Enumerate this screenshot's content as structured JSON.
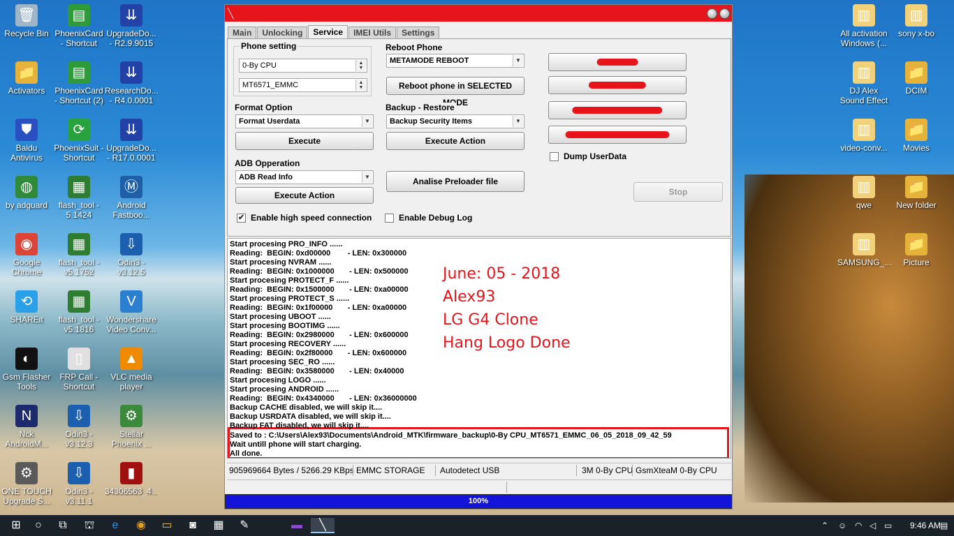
{
  "desktop": {
    "left_icons": [
      {
        "label": "Recycle Bin",
        "icon": "recycle-bin-icon",
        "glyph": "🗑",
        "color": "#9fb6c8"
      },
      {
        "label": "PhoenixCard\n- Shortcut",
        "icon": "phoenixcard-icon",
        "glyph": "▤",
        "color": "#2e9a3a"
      },
      {
        "label": "UpgradeDo...\n- R2.9.9015",
        "icon": "upgrade-download-icon",
        "glyph": "⇊",
        "color": "#2242a8"
      },
      {
        "label": "Activators",
        "icon": "folder-icon",
        "glyph": "📁",
        "color": "#e6b33a"
      },
      {
        "label": "PhoenixCard\n- Shortcut (2)",
        "icon": "phoenixcard-icon",
        "glyph": "▤",
        "color": "#2e9a3a"
      },
      {
        "label": "ResearchDo...\n- R4.0.0001",
        "icon": "research-download-icon",
        "glyph": "⇊",
        "color": "#2242a8"
      },
      {
        "label": "Baidu\nAntivirus",
        "icon": "baidu-antivirus-icon",
        "glyph": "⛊",
        "color": "#2a4fc0"
      },
      {
        "label": "PhoenixSuit -\nShortcut",
        "icon": "phoenixsuit-icon",
        "glyph": "⟳",
        "color": "#27a23c"
      },
      {
        "label": "UpgradeDo...\n- R17.0.0001",
        "icon": "upgrade-download-icon",
        "glyph": "⇊",
        "color": "#2242a8"
      },
      {
        "label": "by adguard",
        "icon": "globe-icon",
        "glyph": "◍",
        "color": "#2f8a3a"
      },
      {
        "label": "flash_tool -\n5.1424",
        "icon": "flash-tool-icon",
        "glyph": "▦",
        "color": "#2e7d32"
      },
      {
        "label": "Android\nFastboo...",
        "icon": "motorola-icon",
        "glyph": "Ⓜ",
        "color": "#1f5fa8"
      },
      {
        "label": "Google\nChrome",
        "icon": "chrome-icon",
        "glyph": "◉",
        "color": "#db4437"
      },
      {
        "label": "flash_tool -\nv5.1752",
        "icon": "flash-tool-icon",
        "glyph": "▦",
        "color": "#2e7d32"
      },
      {
        "label": "Odin3 -\nv3.12.5",
        "icon": "odin-icon",
        "glyph": "⇩",
        "color": "#1c5fae"
      },
      {
        "label": "SHAREit",
        "icon": "shareit-icon",
        "glyph": "⟲",
        "color": "#2aa0e8"
      },
      {
        "label": "flash_tool -\nv5.1816",
        "icon": "flash-tool-icon",
        "glyph": "▦",
        "color": "#2e7d32"
      },
      {
        "label": "Wondershare\nVideo Conv...",
        "icon": "wondershare-icon",
        "glyph": "V",
        "color": "#2a7fd0"
      },
      {
        "label": "Gsm Flasher\nTools",
        "icon": "gsm-flasher-icon",
        "glyph": "◐",
        "color": "#111111"
      },
      {
        "label": "FRP Call -\nShortcut",
        "icon": "frp-call-icon",
        "glyph": "▯",
        "color": "#e0e0e0"
      },
      {
        "label": "VLC media\nplayer",
        "icon": "vlc-icon",
        "glyph": "▲",
        "color": "#f08a00"
      },
      {
        "label": "Nck\nAndroidM...",
        "icon": "nck-icon",
        "glyph": "N",
        "color": "#1d2a6b"
      },
      {
        "label": "Odin3 -\nv3.12.3",
        "icon": "odin-icon",
        "glyph": "⇩",
        "color": "#1c5fae"
      },
      {
        "label": "Stellar\nPhoenix ...",
        "icon": "stellar-icon",
        "glyph": "⚙",
        "color": "#3b8a3b"
      },
      {
        "label": "ONE TOUCH\nUpgrade S...",
        "icon": "one-touch-icon",
        "glyph": "⚙",
        "color": "#5a5a5a"
      },
      {
        "label": "Odin3 -\nv3.11.1",
        "icon": "odin-icon",
        "glyph": "⇩",
        "color": "#1c5fae"
      },
      {
        "label": "34306563_4...",
        "icon": "image-file-icon",
        "glyph": "▮",
        "color": "#a01010"
      }
    ],
    "right_icons": [
      {
        "label": "All activation\nWindows (...",
        "icon": "zip-folder-icon",
        "glyph": "▥",
        "color": "#f1d27a"
      },
      {
        "label": "sony x-bo",
        "icon": "zip-folder-icon",
        "glyph": "▥",
        "color": "#f1d27a"
      },
      {
        "label": "DJ Alex\nSound Effect",
        "icon": "zip-folder-icon",
        "glyph": "▥",
        "color": "#f1d27a"
      },
      {
        "label": "DCIM",
        "icon": "folder-icon",
        "glyph": "📁",
        "color": "#e6b33a"
      },
      {
        "label": "video-conv...",
        "icon": "zip-folder-icon",
        "glyph": "▥",
        "color": "#f1d27a"
      },
      {
        "label": "Movies",
        "icon": "folder-icon",
        "glyph": "📁",
        "color": "#e6b33a"
      },
      {
        "label": "qwe",
        "icon": "zip-folder-icon",
        "glyph": "▥",
        "color": "#f1d27a"
      },
      {
        "label": "New folder",
        "icon": "folder-icon",
        "glyph": "📁",
        "color": "#e6b33a"
      },
      {
        "label": "SAMSUNG_...",
        "icon": "zip-folder-icon",
        "glyph": "▥",
        "color": "#f1d27a"
      },
      {
        "label": "Picture",
        "icon": "folder-icon",
        "glyph": "📁",
        "color": "#e6b33a"
      }
    ]
  },
  "window": {
    "tabs": [
      "Main",
      "Unlocking",
      "Service",
      "IMEI Utils",
      "Settings"
    ],
    "active_tab": "Service",
    "phone_setting": {
      "label": "Phone setting",
      "cpu_value": "0-By CPU",
      "storage_value": "MT6571_EMMC"
    },
    "reboot_phone": {
      "label": "Reboot Phone",
      "mode_value": "METAMODE REBOOT",
      "button": "Reboot phone in SELECTED MODE"
    },
    "format_option": {
      "label": "Format Option",
      "value": "Format Userdata",
      "button": "Execute"
    },
    "backup_restore": {
      "label": "Backup - Restore",
      "value": "Backup Security Items",
      "button": "Execute Action"
    },
    "adb_operation": {
      "label": "ADB Opperation",
      "value": "ADB Read Info",
      "button": "Execute Action"
    },
    "analise_button": "Analise Preloader file",
    "dump_userdata": "Dump UserData",
    "stop_button": "Stop",
    "high_speed": "Enable high speed connection",
    "debug_log": "Enable Debug Log",
    "accent": "#e8141c"
  },
  "log": {
    "lines": [
      "Start procesing PRO_INFO ......",
      "Reading:  BEGIN: 0xd00000        - LEN: 0x300000",
      "Start procesing NVRAM ......",
      "Reading:  BEGIN: 0x1000000       - LEN: 0x500000",
      "Start procesing PROTECT_F ......",
      "Reading:  BEGIN: 0x1500000       - LEN: 0xa00000",
      "Start procesing PROTECT_S ......",
      "Reading:  BEGIN: 0x1f00000       - LEN: 0xa00000",
      "Start procesing UBOOT ......",
      "Start procesing BOOTIMG ......",
      "Reading:  BEGIN: 0x2980000       - LEN: 0x600000",
      "Start procesing RECOVERY ......",
      "Reading:  BEGIN: 0x2f80000       - LEN: 0x600000",
      "Start procesing SEC_RO ......",
      "Reading:  BEGIN: 0x3580000       - LEN: 0x40000",
      "Start procesing LOGO ......",
      "Start procesing ANDROID ......",
      "Reading:  BEGIN: 0x4340000       - LEN: 0x36000000",
      "Backup CACHE disabled, we will skip it....",
      "Backup USRDATA disabled, we will skip it....",
      "Backup FAT disabled, we will skip it....",
      "Saved to : C:\\Users\\Alex93\\Documents\\Android_MTK\\firmware_backup\\0-By CPU_MT6571_EMMC_06_05_2018_09_42_59",
      "Wait untill phone will start charging.",
      "All done."
    ],
    "note": [
      "June: 05 - 2018",
      "Alex93",
      "LG G4 Clone",
      "Hang Logo Done"
    ]
  },
  "status": {
    "bytes": "905969664 Bytes / 5266.29 KBps",
    "storage": "EMMC STORAGE",
    "usb": "Autodetect USB",
    "cpu": "3M 0-By CPU",
    "team": "GsmXteaM 0-By CPU",
    "progress_label": "100%",
    "progress_fraction": 1.0
  },
  "taskbar": {
    "time": "9:46 AM"
  }
}
